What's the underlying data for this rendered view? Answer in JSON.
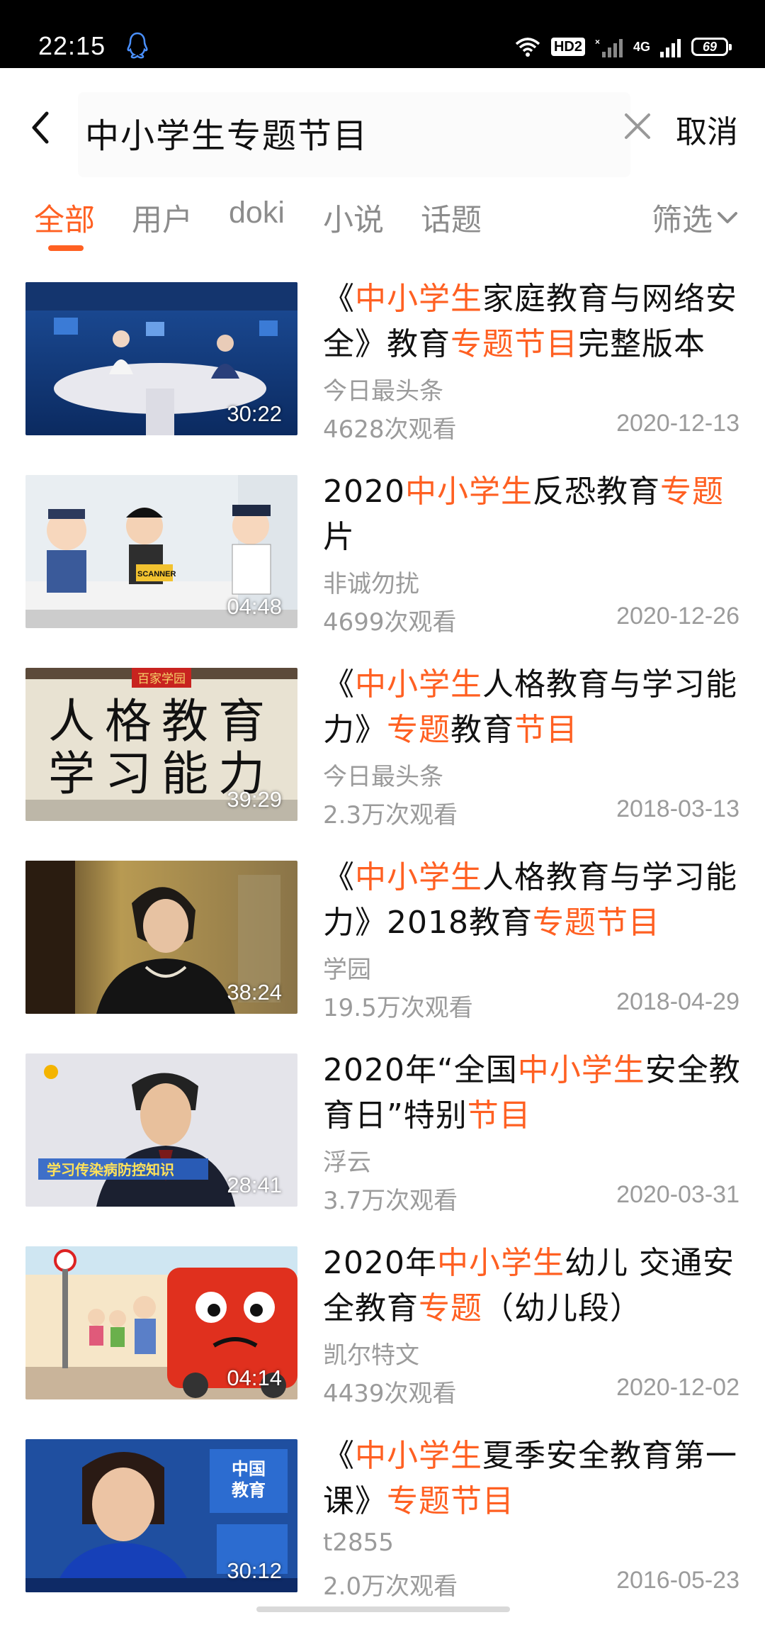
{
  "status_bar": {
    "time": "22:15",
    "hd_label": "HD2",
    "network_label": "4G",
    "battery_level": "69"
  },
  "search": {
    "query": "中小学生专题节目",
    "cancel_label": "取消"
  },
  "tabs": [
    {
      "label": "全部",
      "active": true
    },
    {
      "label": "用户",
      "active": false
    },
    {
      "label": "doki",
      "active": false
    },
    {
      "label": "小说",
      "active": false
    },
    {
      "label": "话题",
      "active": false
    }
  ],
  "filter_label": "筛选",
  "accent_color": "#ff6022",
  "results": [
    {
      "title_parts": [
        {
          "text": "《",
          "hl": false
        },
        {
          "text": "中小学生",
          "hl": true
        },
        {
          "text": "家庭教育与网络安全》教育",
          "hl": false
        },
        {
          "text": "专题节目",
          "hl": true
        },
        {
          "text": "完整版本",
          "hl": false
        }
      ],
      "uploader": "今日最头条",
      "views": "4628次观看",
      "date": "2020-12-13",
      "duration": "30:22"
    },
    {
      "title_parts": [
        {
          "text": "2020",
          "hl": false
        },
        {
          "text": "中小学生",
          "hl": true
        },
        {
          "text": "反恐教育",
          "hl": false
        },
        {
          "text": "专题",
          "hl": true
        },
        {
          "text": "片",
          "hl": false
        }
      ],
      "uploader": "非诚勿扰",
      "views": "4699次观看",
      "date": "2020-12-26",
      "duration": "04:48"
    },
    {
      "title_parts": [
        {
          "text": "《",
          "hl": false
        },
        {
          "text": "中小学生",
          "hl": true
        },
        {
          "text": "人格教育与学习能力》",
          "hl": false
        },
        {
          "text": "专题",
          "hl": true
        },
        {
          "text": "教育",
          "hl": false
        },
        {
          "text": "节目",
          "hl": true
        }
      ],
      "uploader": "今日最头条",
      "views": "2.3万次观看",
      "date": "2018-03-13",
      "duration": "39:29"
    },
    {
      "title_parts": [
        {
          "text": "《",
          "hl": false
        },
        {
          "text": "中小学生",
          "hl": true
        },
        {
          "text": "人格教育与学习能力》2018教育",
          "hl": false
        },
        {
          "text": "专题节目",
          "hl": true
        }
      ],
      "uploader": "学园",
      "views": "19.5万次观看",
      "date": "2018-04-29",
      "duration": "38:24"
    },
    {
      "title_parts": [
        {
          "text": "2020年“全国",
          "hl": false
        },
        {
          "text": "中小学生",
          "hl": true
        },
        {
          "text": "安全教育日”特别",
          "hl": false
        },
        {
          "text": "节目",
          "hl": true
        }
      ],
      "uploader": "浮云",
      "views": "3.7万次观看",
      "date": "2020-03-31",
      "duration": "28:41"
    },
    {
      "title_parts": [
        {
          "text": "2020年",
          "hl": false
        },
        {
          "text": "中小学生",
          "hl": true
        },
        {
          "text": "幼儿 交通安全教育",
          "hl": false
        },
        {
          "text": "专题",
          "hl": true
        },
        {
          "text": "（幼儿段）",
          "hl": false
        }
      ],
      "uploader": "凯尔特文",
      "views": "4439次观看",
      "date": "2020-12-02",
      "duration": "04:14"
    },
    {
      "title_parts": [
        {
          "text": "《",
          "hl": false
        },
        {
          "text": "中小学生",
          "hl": true
        },
        {
          "text": "夏季安全教育第一课》",
          "hl": false
        },
        {
          "text": "专题节目",
          "hl": true
        }
      ],
      "uploader": "t2855",
      "views": "2.0万次观看",
      "date": "2016-05-23",
      "duration": "30:12"
    }
  ],
  "thumbnail_text": {
    "t2_scanner": "SCANNER",
    "t3_badge": "百家学园",
    "t3_line1": "人格教育",
    "t3_line2": "学习能力",
    "t5_caption": "学习传染病防控知识",
    "t7_logo_line1": "中国",
    "t7_logo_line2": "教育"
  }
}
